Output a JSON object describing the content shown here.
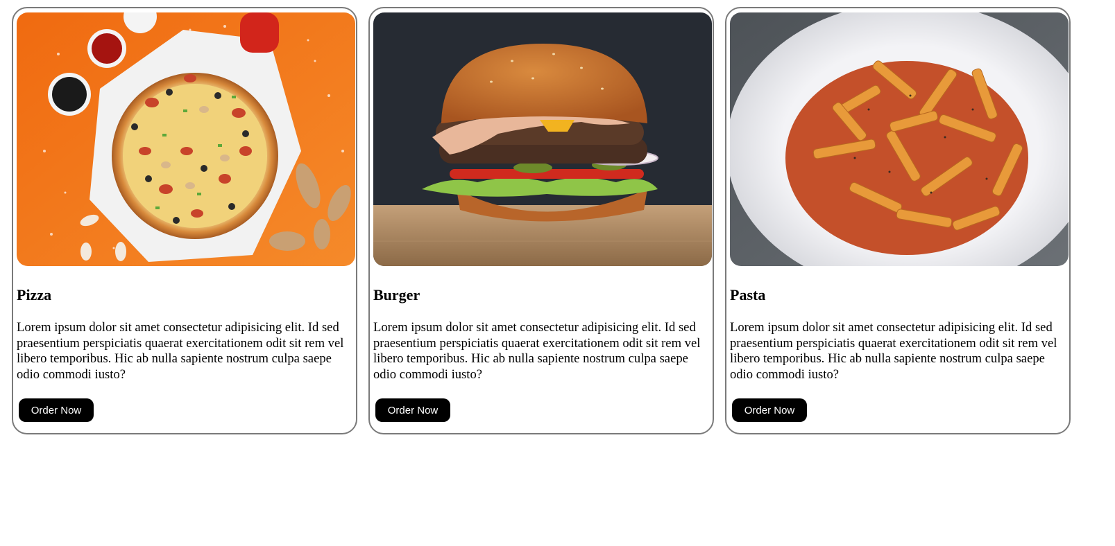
{
  "cards": [
    {
      "title": "Pizza",
      "description": "Lorem ipsum dolor sit amet consectetur adipisicing elit. Id sed praesentium perspiciatis quaerat exercitationem odit sit rem vel libero temporibus. Hic ab nulla sapiente nostrum culpa saepe odio commodi iusto?",
      "button_label": "Order Now",
      "image_alt": "Pizza"
    },
    {
      "title": "Burger",
      "description": "Lorem ipsum dolor sit amet consectetur adipisicing elit. Id sed praesentium perspiciatis quaerat exercitationem odit sit rem vel libero temporibus. Hic ab nulla sapiente nostrum culpa saepe odio commodi iusto?",
      "button_label": "Order Now",
      "image_alt": "Burger"
    },
    {
      "title": "Pasta",
      "description": "Lorem ipsum dolor sit amet consectetur adipisicing elit. Id sed praesentium perspiciatis quaerat exercitationem odit sit rem vel libero temporibus. Hic ab nulla sapiente nostrum culpa saepe odio commodi iusto?",
      "button_label": "Order Now",
      "image_alt": "Pasta"
    }
  ],
  "colors": {
    "button_bg": "#000000",
    "button_text": "#ffffff",
    "card_border": "#7a7a7a"
  }
}
